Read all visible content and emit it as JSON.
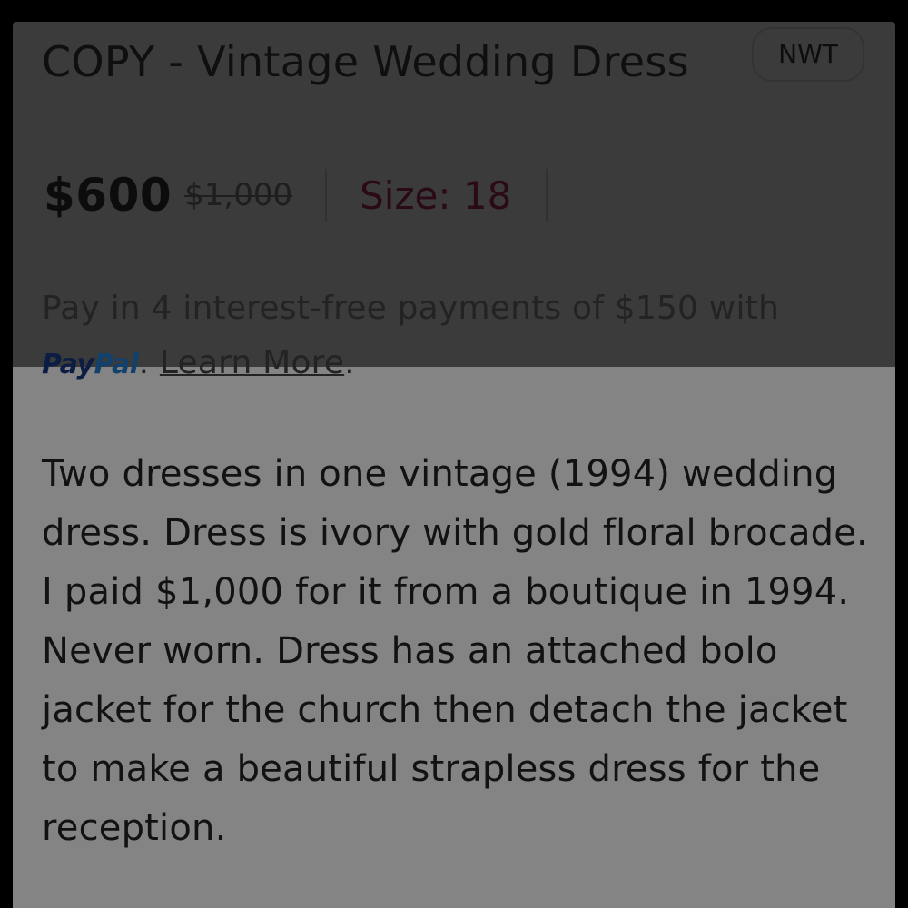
{
  "listing": {
    "title": "COPY - Vintage Wedding Dress",
    "condition_badge": "NWT",
    "price": "$600",
    "original_price": "$1,000",
    "size_label": "Size: 18"
  },
  "payment": {
    "text_before": "Pay in 4 interest-free payments of $150 with ",
    "paypal_part1": "Pay",
    "paypal_part2": "Pal",
    "text_between": ". ",
    "learn_more": "Learn More",
    "text_after": "."
  },
  "description": "Two dresses in one vintage (1994) wedding dress. Dress is ivory with gold floral brocade. I paid $1,000 for it from a boutique in 1994. Never worn. Dress has an attached bolo jacket for the church then detach the jacket to make a beautiful strapless dress for the reception.",
  "colors": {
    "screen_background": "#000000",
    "dimmed_area": "#3b3b3b",
    "lit_area": "#848484",
    "size_accent": "#2b0a18",
    "paypal_dark_blue": "#0c1d44",
    "paypal_light_blue": "#12416b"
  }
}
